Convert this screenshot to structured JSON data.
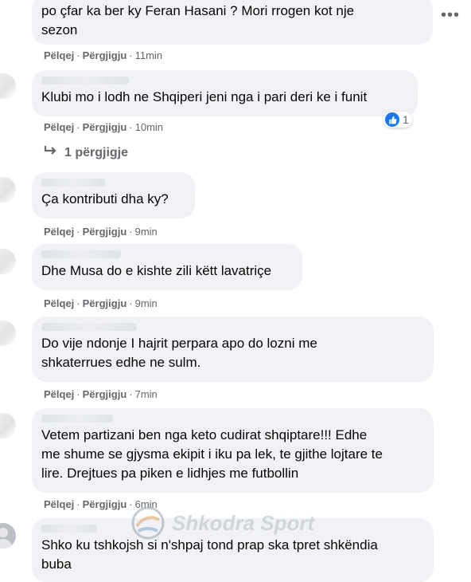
{
  "action_labels": {
    "like": "Pëlqej",
    "reply": "Përgjigju"
  },
  "comments": [
    {
      "text": "po çfar ka ber ky Feran Hasani ? Mori rrogen kot nje\nsezon",
      "time": "11min"
    },
    {
      "text": "Klubi mo i lodh ne Shqiperi jeni nga i pari deri ke i funit",
      "time": "10min",
      "reaction_count": "1",
      "replies_label": "1 përgjigje"
    },
    {
      "text": "Ça kontributi dha ky?",
      "time": "9min"
    },
    {
      "text": "Dhe Musa do e kishte zili këtt lavatriçe",
      "time": "9min"
    },
    {
      "text": "Do vije ndonje I hajrit perpara apo do lozni me\nshkaterrues edhe ne sulm.",
      "time": "7min"
    },
    {
      "text": "Vetem partizani ben nga keto cudirat shqiptare!!! Edhe\nme shume se gjysma ekipit i iku pa lek, te gjithe lojtare te\nlire. Drejtues pa piken e lidhjes me futbollin",
      "time": "6min"
    },
    {
      "text": "Shko ku tshkojsh si n'shpaj tond prap ska tpret shkëndia\nbuba",
      "time": ""
    }
  ],
  "more_icon": "•••",
  "watermark": "Shkodra Sport",
  "colors": {
    "bubble": "#f0f2f5",
    "meta": "#65676b",
    "like_blue": "#1877f2"
  }
}
